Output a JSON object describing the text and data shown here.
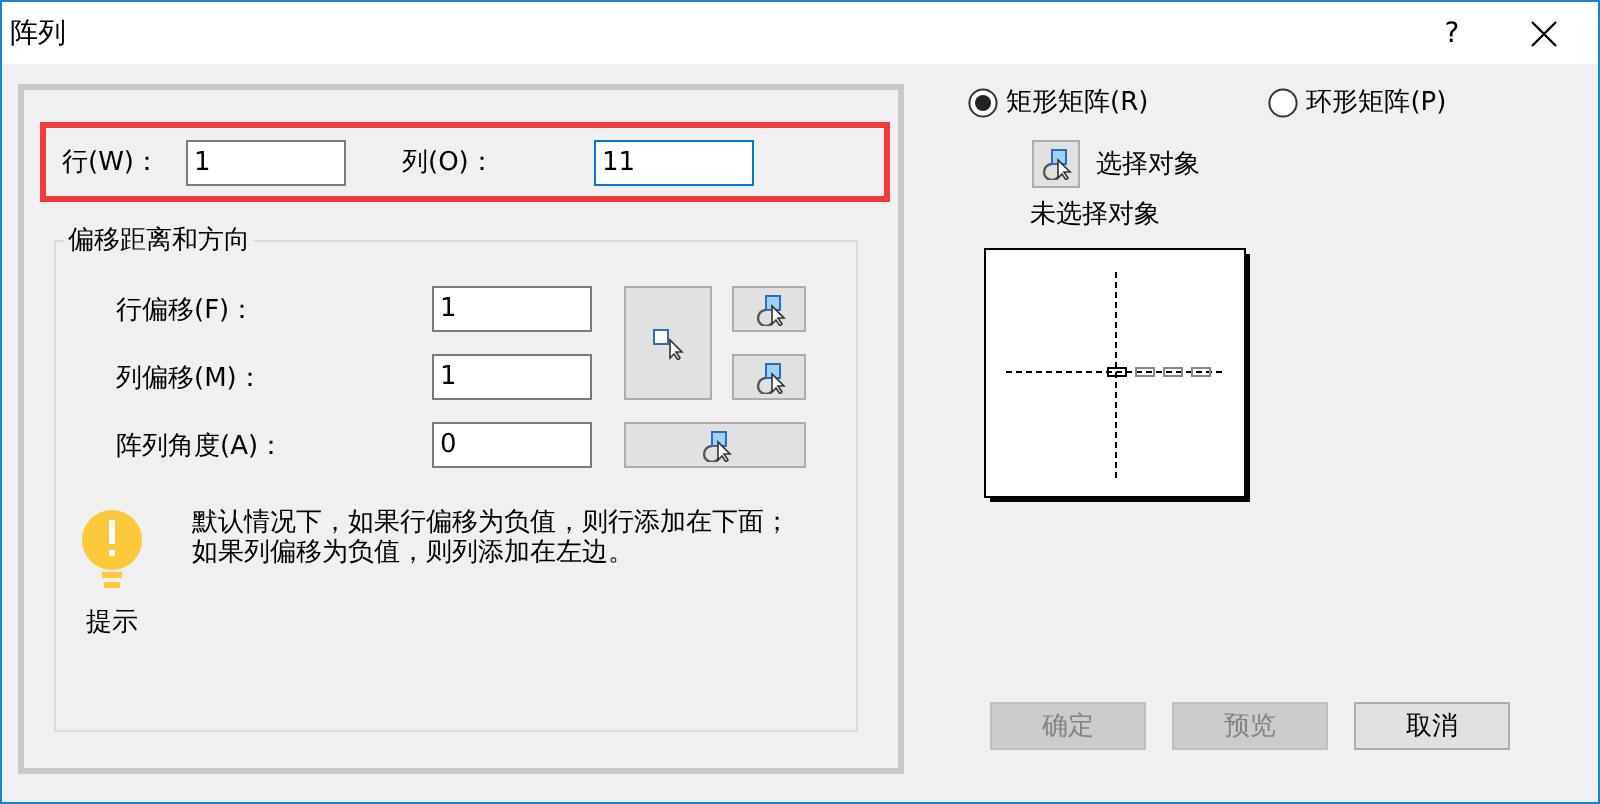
{
  "window": {
    "title": "阵列",
    "help": "?"
  },
  "count_fields": [
    {
      "label": "行(W)：",
      "value": "1",
      "focused": false
    },
    {
      "label": "列(O)：",
      "value": "11",
      "focused": true
    }
  ],
  "offset_group": {
    "title": "偏移距离和方向",
    "rows": [
      {
        "label": "行偏移(F)：",
        "value": "1"
      },
      {
        "label": "列偏移(M)：",
        "value": "1"
      },
      {
        "label": "阵列角度(A)：",
        "value": "0"
      }
    ],
    "hint": {
      "caption": "提示",
      "text": "默认情况下，如果行偏移为负值，则行添加在下面；如果列偏移为负值，则列添加在左边。"
    }
  },
  "array_types": [
    {
      "label": "矩形矩阵(R)",
      "selected": true
    },
    {
      "label": "环形矩阵(P)",
      "selected": false
    }
  ],
  "select_objects": {
    "label": "选择对象",
    "status": "未选择对象"
  },
  "buttons": [
    {
      "label": "确定",
      "disabled": true
    },
    {
      "label": "预览",
      "disabled": true
    },
    {
      "label": "取消",
      "disabled": false
    }
  ]
}
